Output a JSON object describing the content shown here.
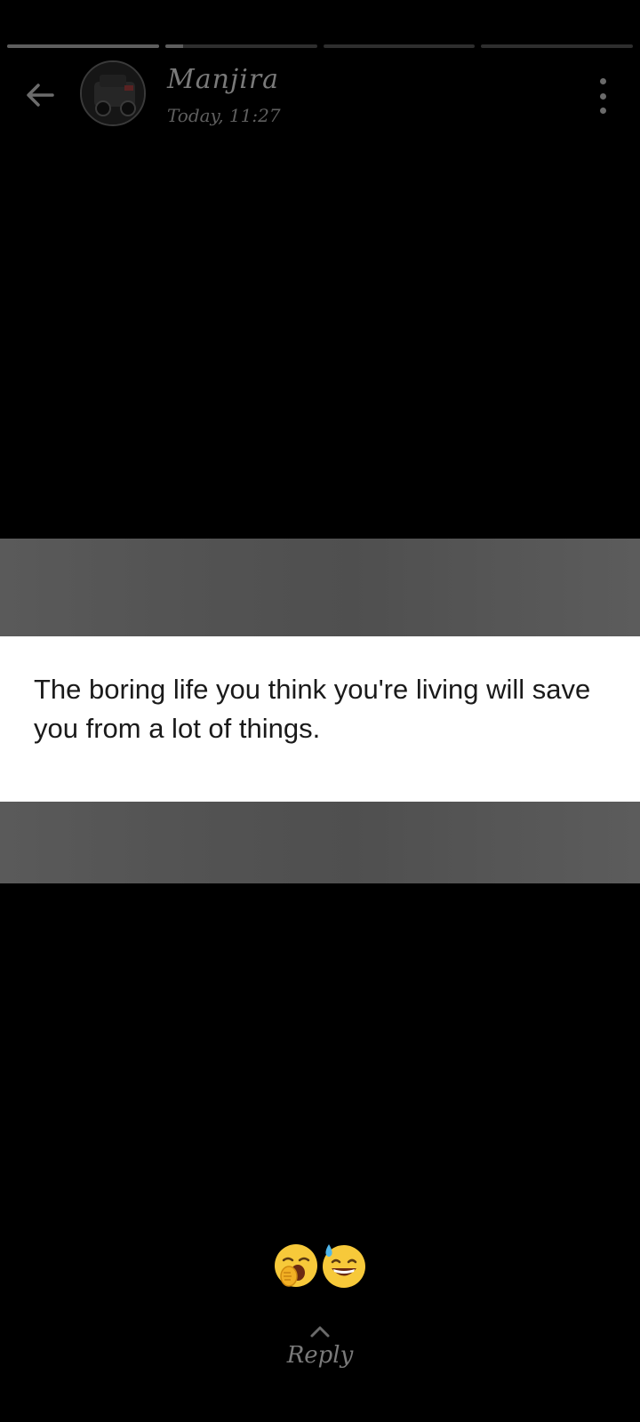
{
  "progress": {
    "segments": [
      {
        "fill": 1.0
      },
      {
        "fill": 0.12
      },
      {
        "fill": 0.0
      },
      {
        "fill": 0.0
      }
    ],
    "colors": {
      "track": "#2e2e2e",
      "fill": "#5e5e5e"
    }
  },
  "header": {
    "back_icon": "arrow-left-icon",
    "user_name": "Manjira",
    "post_time": "Today, 11:27",
    "more_icon": "more-vertical-icon"
  },
  "story": {
    "quote": "The boring life you think you're living will save you from a lot of things."
  },
  "reactions": {
    "icons": [
      "yawning-face-icon",
      "grinning-face-with-sweat-icon"
    ]
  },
  "reply": {
    "icon": "chevron-up-icon",
    "label": "Reply"
  }
}
